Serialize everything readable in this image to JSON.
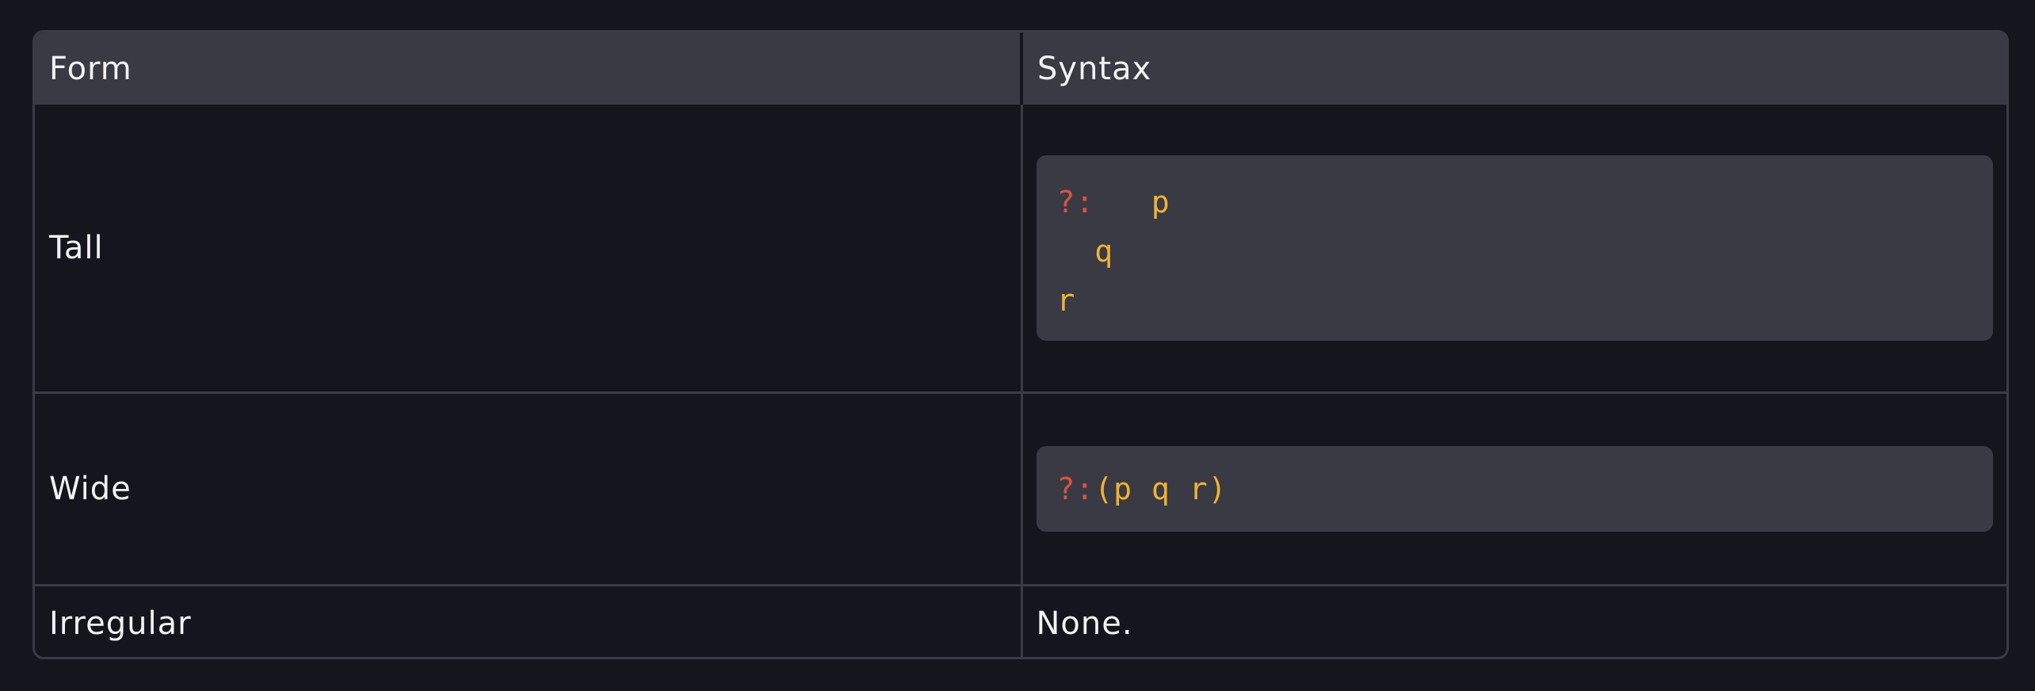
{
  "table": {
    "headers": {
      "form": "Form",
      "syntax": "Syntax"
    },
    "rows": [
      {
        "form": "Tall",
        "syntax_lines": [
          {
            "op": "?:",
            "indent_after_op": "   ",
            "var": "p"
          },
          {
            "indent": "  ",
            "var": "q"
          },
          {
            "indent": "",
            "var": "r"
          }
        ]
      },
      {
        "form": "Wide",
        "syntax": {
          "op": "?:",
          "open": "(",
          "vars": [
            "p",
            "q",
            "r"
          ],
          "close": ")"
        }
      },
      {
        "form": "Irregular",
        "syntax_text": "None."
      }
    ]
  },
  "colors": {
    "background": "#14151d",
    "header_bg": "#393a44",
    "code_bg": "#393a44",
    "rune_color": "#d9533f",
    "var_color": "#f0b232",
    "border": "#3a3b44"
  }
}
